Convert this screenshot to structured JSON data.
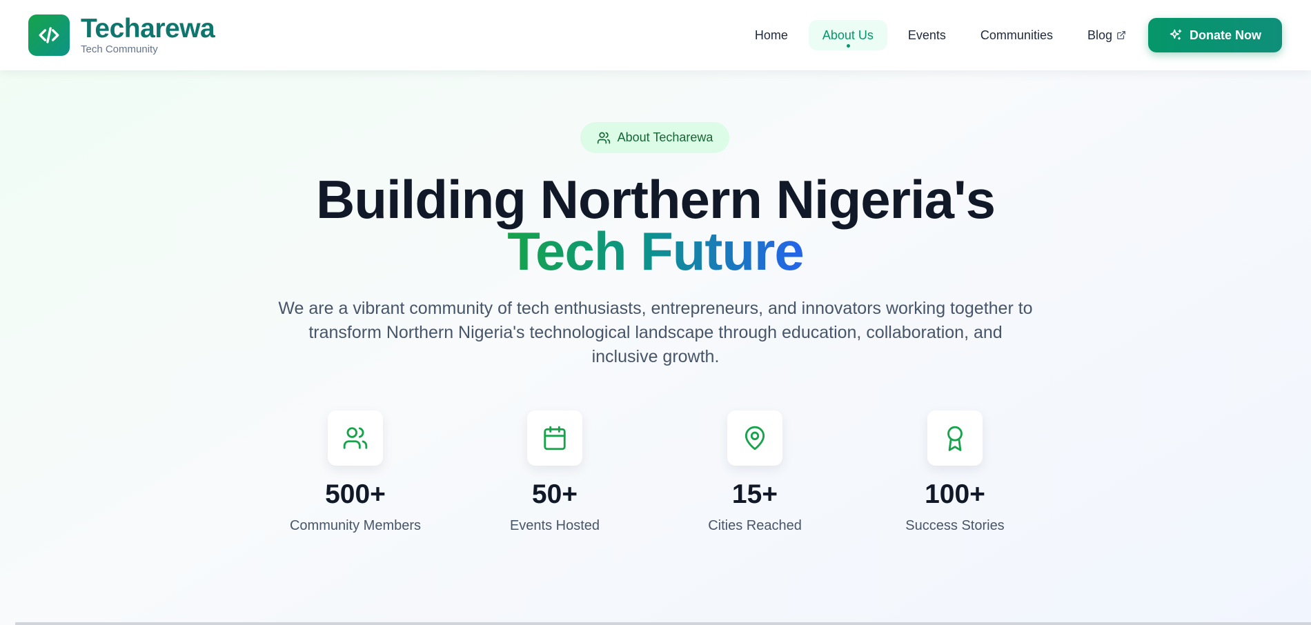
{
  "brand": {
    "name": "Techarewa",
    "tagline": "Tech Community"
  },
  "nav": {
    "items": [
      {
        "label": "Home",
        "active": false
      },
      {
        "label": "About Us",
        "active": true
      },
      {
        "label": "Events",
        "active": false
      },
      {
        "label": "Communities",
        "active": false
      },
      {
        "label": "Blog",
        "active": false,
        "external": true
      }
    ],
    "donate_label": "Donate Now"
  },
  "hero": {
    "badge": "About Techarewa",
    "title_line1": "Building Northern Nigeria's",
    "title_line2": "Tech Future",
    "description": "We are a vibrant community of tech enthusiasts, entrepreneurs, and innovators working together to transform Northern Nigeria's technological landscape through education, collaboration, and inclusive growth."
  },
  "stats": [
    {
      "icon": "users-icon",
      "value": "500+",
      "label": "Community Members"
    },
    {
      "icon": "calendar-icon",
      "value": "50+",
      "label": "Events Hosted"
    },
    {
      "icon": "map-pin-icon",
      "value": "15+",
      "label": "Cities Reached"
    },
    {
      "icon": "award-icon",
      "value": "100+",
      "label": "Success Stories"
    }
  ],
  "colors": {
    "brand_green": "#059669",
    "brand_teal": "#0f766e",
    "accent_blue": "#2563eb",
    "badge_bg": "#dcfce7"
  }
}
